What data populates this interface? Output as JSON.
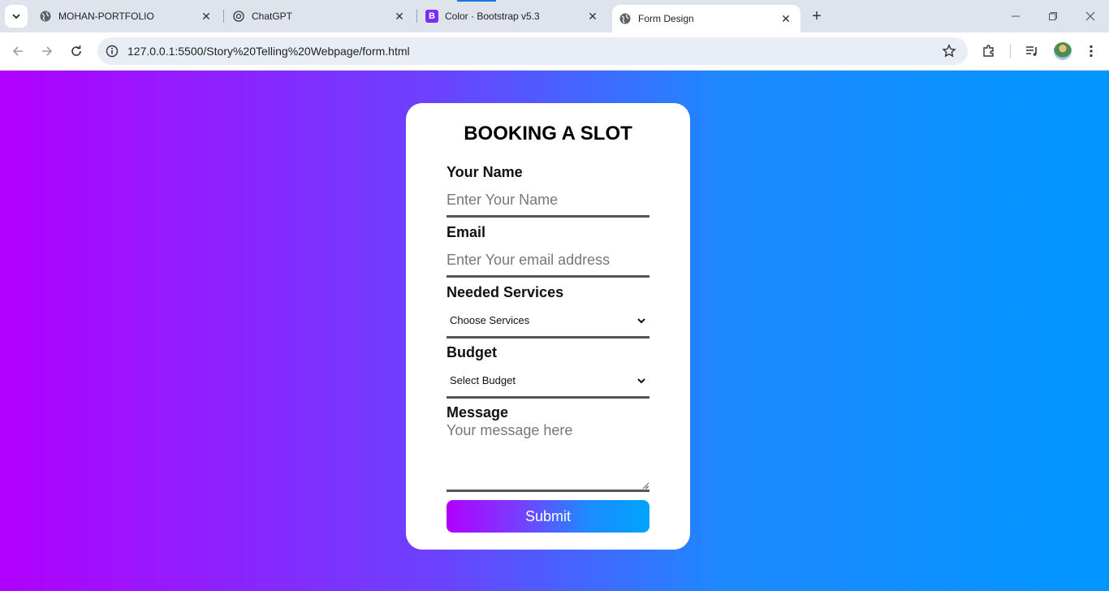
{
  "browser": {
    "tabs": [
      {
        "title": "MOHAN-PORTFOLIO",
        "icon": "globe-icon"
      },
      {
        "title": "ChatGPT",
        "icon": "chatgpt-icon"
      },
      {
        "title": "Color · Bootstrap v5.3",
        "icon": "bootstrap-icon"
      },
      {
        "title": "Form Design",
        "icon": "globe-icon"
      }
    ],
    "bootstrap_letter": "B",
    "url": "127.0.0.1:5500/Story%20Telling%20Webpage/form.html"
  },
  "form": {
    "title": "BOOKING A SLOT",
    "name_label": "Your Name",
    "name_placeholder": "Enter Your Name",
    "email_label": "Email",
    "email_placeholder": "Enter Your email address",
    "services_label": "Needed Services",
    "services_selected": "Choose Services",
    "budget_label": "Budget",
    "budget_selected": "Select Budget",
    "message_label": "Message",
    "message_placeholder": "Your message here",
    "submit_label": "Submit"
  },
  "colors": {
    "gradient_start": "#b100ff",
    "gradient_end": "#0096ff",
    "card_bg": "#ffffff",
    "input_underline": "#555555"
  }
}
